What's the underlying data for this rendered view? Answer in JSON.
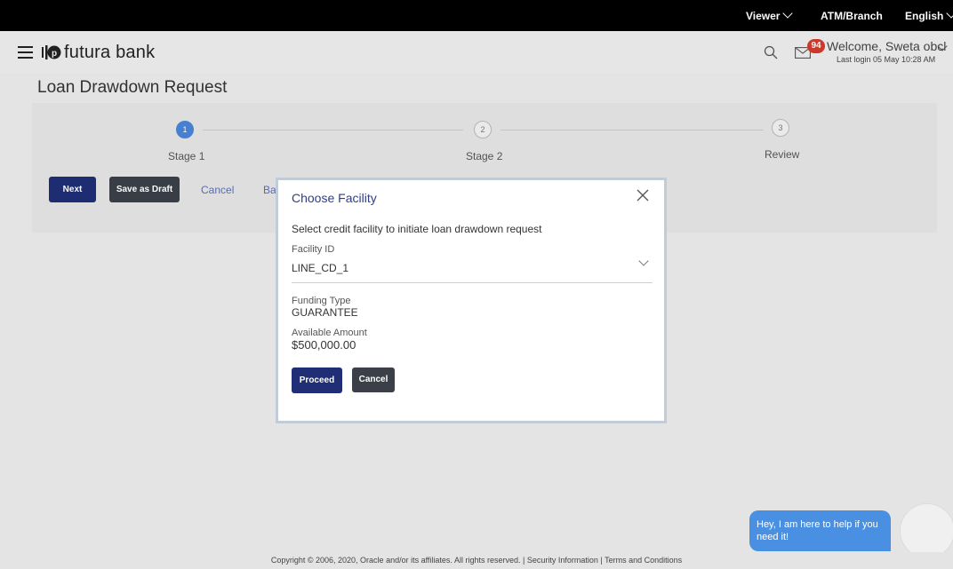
{
  "topbar": {
    "viewer": "Viewer",
    "atm_branch": "ATM/Branch",
    "language": "English"
  },
  "header": {
    "brand": "futura bank",
    "notifications_count": "94",
    "welcome": "Welcome, Sweta obcl",
    "last_login": "Last login 05 May 10:28 AM"
  },
  "page": {
    "title": "Loan Drawdown Request"
  },
  "stages": [
    {
      "number": "1",
      "label": "Stage 1",
      "state": "active"
    },
    {
      "number": "2",
      "label": "Stage 2",
      "state": "pending"
    },
    {
      "number": "3",
      "label": "Review",
      "state": "pending"
    }
  ],
  "actions": {
    "next": "Next",
    "save_draft": "Save as Draft",
    "cancel": "Cancel",
    "back": "Ba"
  },
  "modal": {
    "title": "Choose Facility",
    "instruction": "Select credit facility to initiate loan drawdown request",
    "facility_label": "Facility ID",
    "facility_value": "LINE_CD_1",
    "funding_type_label": "Funding Type",
    "funding_type_value": "GUARANTEE",
    "available_amount_label": "Available Amount",
    "available_amount_value": "$500,000.00",
    "proceed": "Proceed",
    "cancel": "Cancel"
  },
  "chat": {
    "message": "Hey, I am here to help if you need it!"
  },
  "footer": {
    "copyright": "Copyright © 2006, 2020, Oracle and/or its affiliates. All rights reserved.",
    "separator": "|",
    "security": "Security Information",
    "terms": "Terms and Conditions"
  },
  "colors": {
    "primary": "#1f2e75",
    "active_step": "#4a83d6",
    "badge": "#d13b2d",
    "chat": "#4a90e2"
  }
}
